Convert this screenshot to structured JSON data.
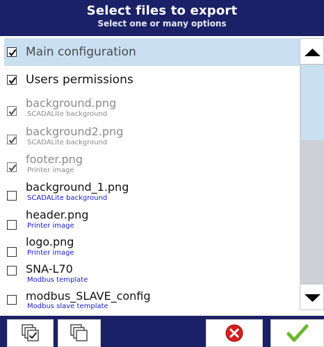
{
  "header": {
    "title": "Select files to export",
    "subtitle": "Select one or many options"
  },
  "items": [
    {
      "name": "Main configuration",
      "description": "",
      "checked": true,
      "enabled": true,
      "selected": true
    },
    {
      "name": "Users permissions",
      "description": "",
      "checked": true,
      "enabled": true,
      "selected": false
    },
    {
      "name": "background.png",
      "description": "SCADALite background",
      "checked": true,
      "enabled": false,
      "selected": false
    },
    {
      "name": "background2.png",
      "description": "SCADALite background",
      "checked": true,
      "enabled": false,
      "selected": false
    },
    {
      "name": "footer.png",
      "description": "Printer image",
      "checked": true,
      "enabled": false,
      "selected": false
    },
    {
      "name": "background_1.png",
      "description": "SCADALite background",
      "checked": false,
      "enabled": true,
      "selected": false
    },
    {
      "name": "header.png",
      "description": "Printer image",
      "checked": false,
      "enabled": true,
      "selected": false
    },
    {
      "name": "logo.png",
      "description": "Printer image",
      "checked": false,
      "enabled": true,
      "selected": false
    },
    {
      "name": "SNA-L70",
      "description": "Modbus template",
      "checked": false,
      "enabled": true,
      "selected": false
    },
    {
      "name": "modbus_SLAVE_config",
      "description": "Modbus slave template",
      "checked": false,
      "enabled": true,
      "selected": false
    }
  ],
  "scrollbar": {
    "position": 0.0
  },
  "footer": {
    "buttons": [
      "select-all-icon",
      "deselect-all-icon",
      "cancel-icon",
      "confirm-icon"
    ]
  },
  "colors": {
    "header_bg": "#1a2167",
    "selected_row": "#c9dff2",
    "description_text": "#1a1acc",
    "disabled_text": "#8a8a8a",
    "cancel_red": "#d42020",
    "confirm_green": "#6ab82c"
  }
}
